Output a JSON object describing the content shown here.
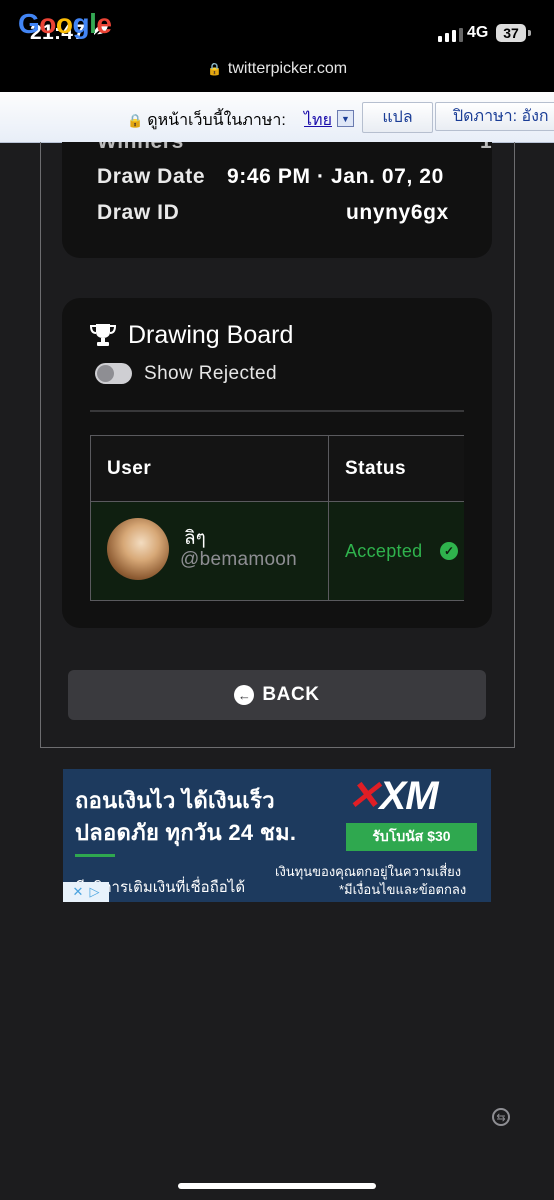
{
  "status_bar": {
    "time": "21:47",
    "network": "4G",
    "battery": "37",
    "url": "twitterpicker.com"
  },
  "translate_bar": {
    "logo": [
      "G",
      "o",
      "o",
      "g",
      "l",
      "e"
    ],
    "prompt": "ดูหน้าเว็บนี้ในภาษา:",
    "language": "ไทย",
    "translate_button": "แปล",
    "turn_off_button": "ปิดภาษา: อังก"
  },
  "draw_info": {
    "partial_label": "Winners",
    "draw_date_label": "Draw Date",
    "draw_date_value": "9:46 PM · Jan. 07, 20",
    "draw_id_label": "Draw ID",
    "draw_id_value": "unyny6gx"
  },
  "drawing_board": {
    "title": "Drawing Board",
    "toggle_label": "Show Rejected",
    "table": {
      "headers": [
        "User",
        "Status"
      ],
      "rows": [
        {
          "name": "ลิๆ",
          "handle": "@bemamoon",
          "status": "Accepted"
        }
      ]
    }
  },
  "back_button": "BACK",
  "ad": {
    "line1": "ถอนเงินไว ได้เงินเร็ว",
    "line2": "ปลอดภัย ทุกวัน 24 ชม.",
    "line3": "มีบริการเติมเงินที่เชื่อถือได้",
    "brand": "XM",
    "bonus": "รับโบนัส $30",
    "disclaimer1": "เงินทุนของคุณตกอยู่ในความเสี่ยง",
    "disclaimer2": "*มีเงื่อนไขและข้อตกลง"
  },
  "colors": {
    "accepted": "#2fb34d",
    "background": "#1c1c1e",
    "card": "#111111"
  }
}
